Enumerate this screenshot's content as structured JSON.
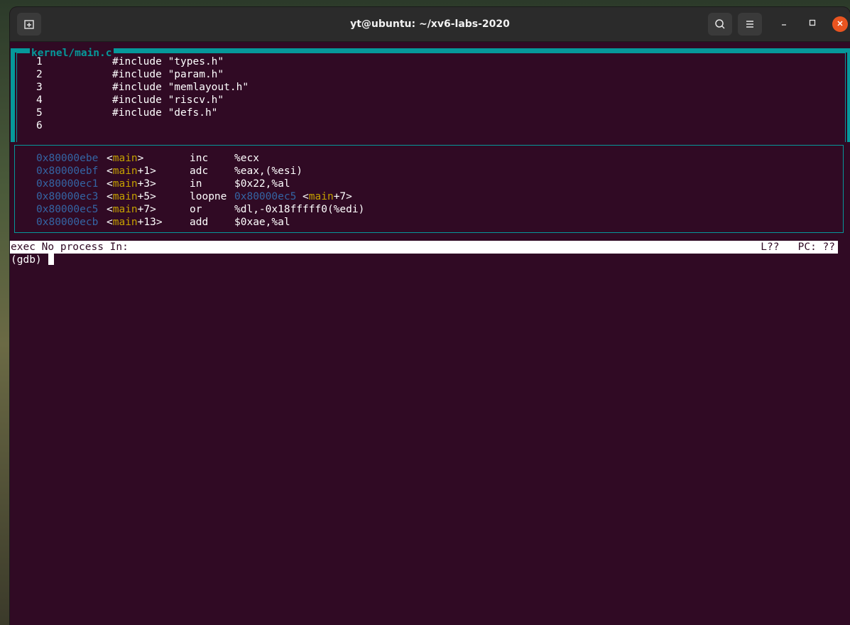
{
  "window": {
    "title": "yt@ubuntu: ~/xv6-labs-2020",
    "new_tab_icon": "new-tab-icon",
    "search_icon": "search-icon",
    "menu_icon": "hamburger-menu-icon",
    "minimize_icon": "minimize-icon",
    "maximize_icon": "maximize-icon",
    "close_icon": "close-icon"
  },
  "source_pane": {
    "title": "kernel/main.c",
    "lines": [
      {
        "num": "1",
        "code": "#include \"types.h\""
      },
      {
        "num": "2",
        "code": "#include \"param.h\""
      },
      {
        "num": "3",
        "code": "#include \"memlayout.h\""
      },
      {
        "num": "4",
        "code": "#include \"riscv.h\""
      },
      {
        "num": "5",
        "code": "#include \"defs.h\""
      },
      {
        "num": "6",
        "code": ""
      }
    ]
  },
  "asm_pane": {
    "lines": [
      {
        "addr": "0x80000ebe",
        "sym_pre": "<",
        "sym": "main",
        "sym_post": ">",
        "op": "inc",
        "arg": "%ecx",
        "arg_addr": "",
        "arg_sym_pre": "",
        "arg_sym": "",
        "arg_sym_post": ""
      },
      {
        "addr": "0x80000ebf",
        "sym_pre": "<",
        "sym": "main",
        "sym_post": "+1>",
        "op": "adc",
        "arg": "%eax,(%esi)",
        "arg_addr": "",
        "arg_sym_pre": "",
        "arg_sym": "",
        "arg_sym_post": ""
      },
      {
        "addr": "0x80000ec1",
        "sym_pre": "<",
        "sym": "main",
        "sym_post": "+3>",
        "op": "in",
        "arg": "$0x22,%al",
        "arg_addr": "",
        "arg_sym_pre": "",
        "arg_sym": "",
        "arg_sym_post": ""
      },
      {
        "addr": "0x80000ec3",
        "sym_pre": "<",
        "sym": "main",
        "sym_post": "+5>",
        "op": "loopne",
        "arg": "",
        "arg_addr": "0x80000ec5",
        "arg_sym_pre": " <",
        "arg_sym": "main",
        "arg_sym_post": "+7>"
      },
      {
        "addr": "0x80000ec5",
        "sym_pre": "<",
        "sym": "main",
        "sym_post": "+7>",
        "op": "or",
        "arg": "%dl,-0x18fffff0(%edi)",
        "arg_addr": "",
        "arg_sym_pre": "",
        "arg_sym": "",
        "arg_sym_post": ""
      },
      {
        "addr": "0x80000ecb",
        "sym_pre": "<",
        "sym": "main",
        "sym_post": "+13>",
        "op": "add",
        "arg": "$0xae,%al",
        "arg_addr": "",
        "arg_sym_pre": "",
        "arg_sym": "",
        "arg_sym_post": ""
      }
    ]
  },
  "status_bar": {
    "left": "exec No process In:",
    "right": "L??   PC: ??"
  },
  "console": {
    "prompt": "(gdb) "
  },
  "colors": {
    "terminal_bg": "#300a24",
    "border": "#06989a",
    "address": "#3465a4",
    "symbol": "#c4a000",
    "close_button": "#e95420"
  }
}
